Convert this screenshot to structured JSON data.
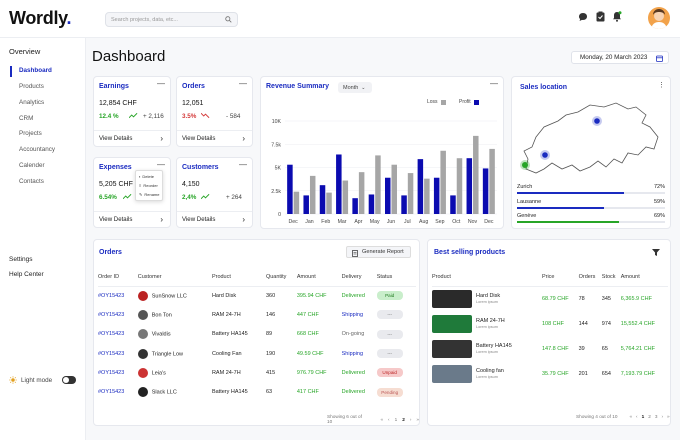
{
  "app": {
    "logo": "Wordly",
    "logo_dot": "."
  },
  "search": {
    "placeholder": "Search projects, data, etc..."
  },
  "sidebar": {
    "heading": "Overview",
    "items": [
      {
        "label": "Dashboard"
      },
      {
        "label": "Products"
      },
      {
        "label": "Analytics"
      },
      {
        "label": "CRM"
      },
      {
        "label": "Projects"
      },
      {
        "label": "Accountancy"
      },
      {
        "label": "Calender"
      },
      {
        "label": "Contacts"
      }
    ],
    "settings": "Settings",
    "help": "Help Center",
    "light_mode": "Light mode"
  },
  "page": {
    "title": "Dashboard",
    "date": "Monday, 20 March 2023"
  },
  "kpis": {
    "earnings": {
      "title": "Earnings",
      "value": "12,854 CHF",
      "pct": "12.4 %",
      "delta": "+ 2,116",
      "link": "View Details"
    },
    "orders": {
      "title": "Orders",
      "value": "12,051",
      "pct": "3.5%",
      "delta": "- 584",
      "link": "View Details"
    },
    "expenses": {
      "title": "Expenses",
      "value": "5,205 CHF",
      "pct": "6.54%",
      "delta": "",
      "link": "View Details"
    },
    "customers": {
      "title": "Customers",
      "value": "4,150",
      "pct": "2,4%",
      "delta": "+ 264",
      "link": "View Details"
    }
  },
  "menu": {
    "items": [
      "Delete",
      "Reorder",
      "Rename"
    ]
  },
  "revenue": {
    "title": "Revenue Summary",
    "period": "Month",
    "legend_loss": "Loss",
    "legend_profit": "Profit"
  },
  "chart_data": {
    "type": "bar",
    "title": "Revenue Summary",
    "categories": [
      "Dec",
      "Jan",
      "Feb",
      "Mar",
      "Apr",
      "May",
      "Jun",
      "Jul",
      "Aug",
      "Sep",
      "Oct",
      "Nov",
      "Dec"
    ],
    "yticks": [
      "0",
      "2.5k",
      "5K",
      "7.5k",
      "10K"
    ],
    "ylim": [
      0,
      10000
    ],
    "series": [
      {
        "name": "Profit",
        "color": "#0b0bb0",
        "values": [
          5300,
          2000,
          3100,
          6400,
          1700,
          2100,
          3900,
          2000,
          5900,
          3900,
          2000,
          6000,
          4900
        ]
      },
      {
        "name": "Loss",
        "color": "#a6a6a6",
        "values": [
          2400,
          4100,
          2300,
          3600,
          4500,
          6300,
          5300,
          4400,
          3800,
          6800,
          6000,
          8400,
          7000
        ]
      }
    ]
  },
  "sales": {
    "title": "Sales location",
    "rows": [
      {
        "city": "Zurich",
        "pct": "72%",
        "value": 72,
        "color": "#1a2bc0"
      },
      {
        "city": "Lausanne",
        "pct": "59%",
        "value": 59,
        "color": "#1a2bc0"
      },
      {
        "city": "Genève",
        "pct": "69%",
        "value": 69,
        "color": "#27a527"
      }
    ]
  },
  "orders_table": {
    "title": "Orders",
    "generate": "Generate Report",
    "headers": [
      "Order ID",
      "Customer",
      "Product",
      "Quantity",
      "Amount",
      "Delivery",
      "Status"
    ],
    "rows": [
      {
        "id": "#OY15423",
        "customer": "SunSnow LLC",
        "product": "Hard Disk",
        "qty": "360",
        "amount": "395.94 CHF",
        "delivery": "Delivered",
        "status": "Paid",
        "cls": "paid",
        "icon": "#b22"
      },
      {
        "id": "#OY15423",
        "customer": "Bon Ton",
        "product": "RAM 24-7H",
        "qty": "146",
        "amount": "447 CHF",
        "delivery": "Shipping",
        "status": "---",
        "cls": "none",
        "icon": "#555"
      },
      {
        "id": "#OY15423",
        "customer": "Vivaldis",
        "product": "Battery HA145",
        "qty": "89",
        "amount": "668 CHF",
        "delivery": "On-going",
        "status": "---",
        "cls": "none",
        "icon": "#777"
      },
      {
        "id": "#OY15423",
        "customer": "Triangle Low",
        "product": "Cooling Fan",
        "qty": "190",
        "amount": "49.59 CHF",
        "delivery": "Shipping",
        "status": "---",
        "cls": "none",
        "icon": "#333"
      },
      {
        "id": "#OY15423",
        "customer": "Leia's",
        "product": "RAM 24-7H",
        "qty": "415",
        "amount": "976.79 CHF",
        "delivery": "Delivered",
        "status": "Unpaid",
        "cls": "unpaid",
        "icon": "#c33"
      },
      {
        "id": "#OY15423",
        "customer": "Slack LLC",
        "product": "Battery HA145",
        "qty": "63",
        "amount": "417 CHF",
        "delivery": "Delivered",
        "status": "Pending",
        "cls": "pending",
        "icon": "#222"
      }
    ],
    "showing": "Showing 6 out of 10",
    "pages": [
      "«",
      "‹",
      "1",
      "2",
      "›",
      "»"
    ]
  },
  "products": {
    "title": "Best selling products",
    "headers": [
      "Product",
      "Price",
      "Orders",
      "Stock",
      "Amount"
    ],
    "rows": [
      {
        "name": "Hard Disk",
        "sub": "Lorem ipsum",
        "price": "68.79 CHF",
        "orders": "78",
        "stock": "345",
        "amount": "6,365.9 CHF",
        "img": "#2a2a2a"
      },
      {
        "name": "RAM 24-7H",
        "sub": "Lorem ipsum",
        "price": "108 CHF",
        "orders": "144",
        "stock": "974",
        "amount": "15,552.4 CHF",
        "img": "#1f7a3a"
      },
      {
        "name": "Battery HA145",
        "sub": "Lorem ipsum",
        "price": "147.8 CHF",
        "orders": "39",
        "stock": "65",
        "amount": "5,764.21 CHF",
        "img": "#333"
      },
      {
        "name": "Cooling fan",
        "sub": "Lorem ipsum",
        "price": "35.79 CHF",
        "orders": "201",
        "stock": "654",
        "amount": "7,193.79 CHF",
        "img": "#6a7a8a"
      }
    ],
    "showing": "Showing 4 out of 10",
    "pages": [
      "«",
      "‹",
      "1",
      "2",
      "3",
      "›",
      "»"
    ]
  }
}
